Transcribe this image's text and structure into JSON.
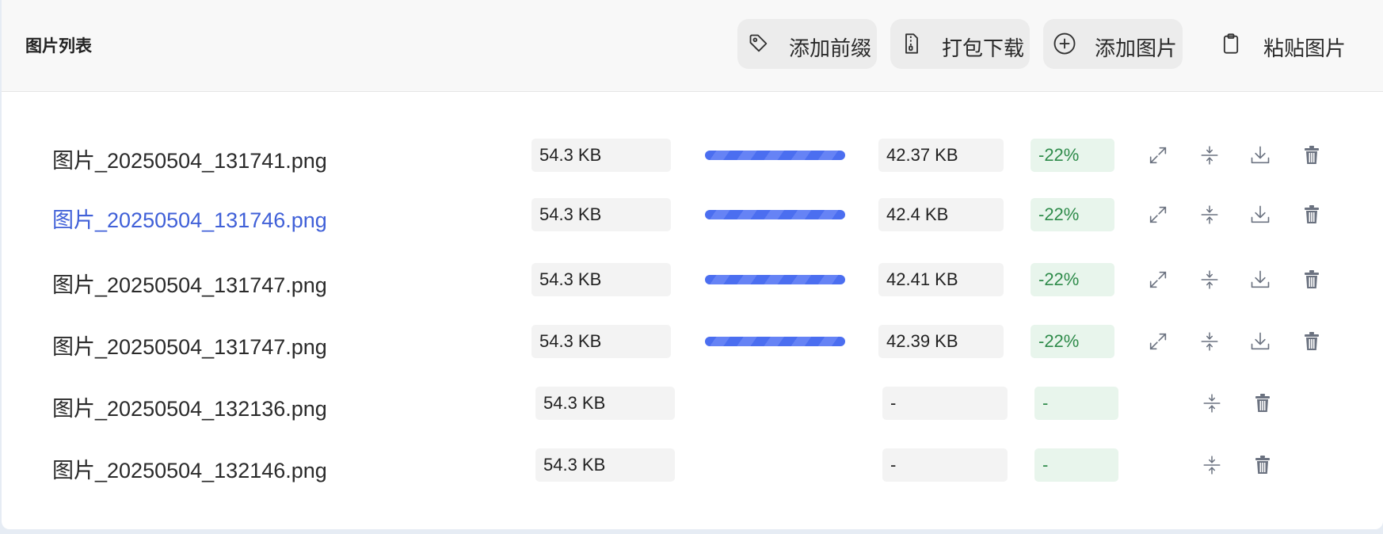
{
  "header": {
    "title": "图片列表",
    "buttons": {
      "add_prefix": "添加前缀",
      "pack_download": "打包下载",
      "add_image": "添加图片",
      "paste_image": "粘贴图片"
    }
  },
  "rows": [
    {
      "name": "图片_20250504_131741.png",
      "size": "54.3 KB",
      "compressed": "42.37 KB",
      "ratio": "-22%",
      "progress": 1.0,
      "highlighted": false,
      "done": true
    },
    {
      "name": "图片_20250504_131746.png",
      "size": "54.3 KB",
      "compressed": "42.4 KB",
      "ratio": "-22%",
      "progress": 1.0,
      "highlighted": true,
      "done": true
    },
    {
      "name": "图片_20250504_131747.png",
      "size": "54.3 KB",
      "compressed": "42.41 KB",
      "ratio": "-22%",
      "progress": 1.0,
      "highlighted": false,
      "done": true
    },
    {
      "name": "图片_20250504_131747.png",
      "size": "54.3 KB",
      "compressed": "42.39 KB",
      "ratio": "-22%",
      "progress": 1.0,
      "highlighted": false,
      "done": true
    },
    {
      "name": "图片_20250504_132136.png",
      "size": "54.3 KB",
      "compressed": "-",
      "ratio": "-",
      "highlighted": false,
      "done": false
    },
    {
      "name": "图片_20250504_132146.png",
      "size": "54.3 KB",
      "compressed": "-",
      "ratio": "-",
      "highlighted": false,
      "done": false
    }
  ],
  "icons": {
    "add_prefix": "tag-icon",
    "pack_download": "zip-file-icon",
    "add_image": "plus-circle-icon",
    "paste_image": "clipboard-icon",
    "expand": "expand-icon",
    "compress": "compress-icon",
    "download": "download-icon",
    "delete": "trash-icon"
  },
  "colors": {
    "accent": "#4b6ef0",
    "link": "#4060d8",
    "success_text": "#2e8b4a",
    "success_bg": "#e8f5ec"
  }
}
